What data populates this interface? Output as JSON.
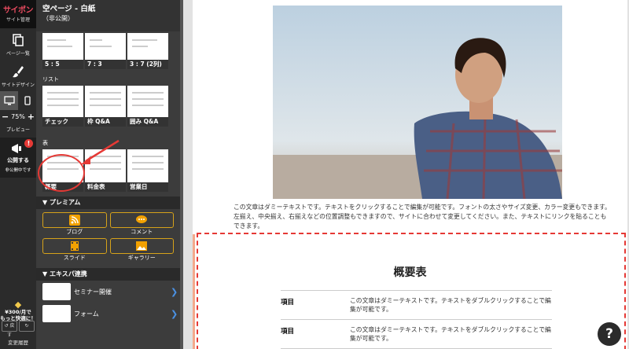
{
  "toolbar": {
    "brand": "サイポン",
    "brand_sub": "サイト管理",
    "pages_label": "ページ一覧",
    "design_label": "サイトデザイン",
    "zoom_level": "75%",
    "zoom_minus": "−",
    "zoom_plus": "+",
    "preview_label": "プレビュー",
    "publish_label": "公開する",
    "publish_status": "非公開中です",
    "publish_badge": "!",
    "promo_line1": "¥300/月で",
    "promo_line2": "もっと快適に！",
    "undo_label": "戻す",
    "history_label": "変更履歴"
  },
  "panel": {
    "title": "空ページ - 白紙",
    "status": "（非公開）",
    "layout_thumbs": [
      "5 : 5",
      "7 : 3",
      "3 : 7 (2列)"
    ],
    "list_label": "リスト",
    "list_thumbs": [
      "チェック",
      "枠 Q&A",
      "囲み Q&A"
    ],
    "table_label": "表",
    "table_thumbs": [
      "概要",
      "料金表",
      "営業日"
    ],
    "premium_header": "プレミアム",
    "premium_items": [
      "ブログ",
      "コメント",
      "スライド",
      "ギャラリー"
    ],
    "ext_header": "エキスパ連携",
    "ext_items": [
      "セミナー開催",
      "フォーム"
    ]
  },
  "canvas": {
    "body_text": "この文章はダミーテキストです。テキストをクリックすることで編集が可能です。フォントの太さやサイズ変更、カラー変更もできます。左揃え、中央揃え、右揃えなどの位置調整もできますので、サイトに合わせて変更してください。また、テキストにリンクを貼ることもできます。",
    "table_title": "概要表",
    "rows": [
      {
        "key": "項目",
        "value": "この文章はダミーテキストです。テキストをダブルクリックすることで編集が可能です。"
      },
      {
        "key": "項目",
        "value": "この文章はダミーテキストです。テキストをダブルクリックすることで編集が可能です。"
      }
    ]
  },
  "help_label": "?",
  "colors": {
    "accent_red": "#e53935",
    "premium_gold": "#d6a21a",
    "arrow_blue": "#4a90e2"
  }
}
